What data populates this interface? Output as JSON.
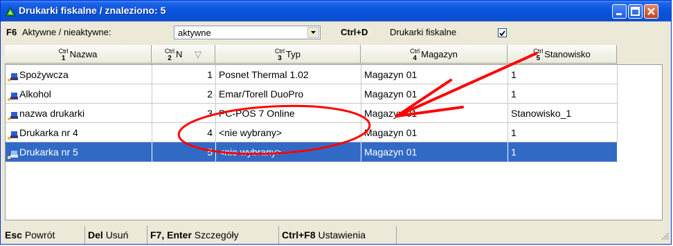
{
  "window": {
    "title": "Drukarki fiskalne / znaleziono: 5"
  },
  "filter": {
    "f6_key": "F6",
    "f6_label": "Aktywne / nieaktywne:",
    "status_value": "aktywne",
    "ctrld_key": "Ctrl+D",
    "ctrld_label": "Drukarki fiskalne",
    "ctrld_checked": true
  },
  "grid": {
    "ctrl_prefix": "Ctrl",
    "columns": [
      {
        "n": "1",
        "label": "Nazwa"
      },
      {
        "n": "2",
        "label": "N"
      },
      {
        "n": "3",
        "label": "Typ"
      },
      {
        "n": "4",
        "label": "Magazyn"
      },
      {
        "n": "5",
        "label": "Stanowisko"
      }
    ],
    "sort_indicator": "▽",
    "rows": [
      {
        "name": "Spożywcza",
        "n": "1",
        "typ": "Posnet Thermal 1.02",
        "magazyn": "Magazyn 01",
        "stanowisko": "1"
      },
      {
        "name": "Alkohol",
        "n": "2",
        "typ": "Emar/Torell DuoPro",
        "magazyn": "Magazyn 01",
        "stanowisko": "1"
      },
      {
        "name": "nazwa drukarki",
        "n": "3",
        "typ": "PC-POS 7 Online",
        "magazyn": "Magazyn 01",
        "stanowisko": "Stanowisko_1"
      },
      {
        "name": "Drukarka nr 4",
        "n": "4",
        "typ": "<nie wybrany>",
        "magazyn": "Magazyn 01",
        "stanowisko": "1"
      },
      {
        "name": "Drukarka nr 5",
        "n": "5",
        "typ": "<nie wybrany>",
        "magazyn": "Magazyn 01",
        "stanowisko": "1"
      }
    ],
    "selected_row": 4
  },
  "statusbar": [
    {
      "key": "Esc",
      "label": "Powrót"
    },
    {
      "key": "Del",
      "label": "Usuń"
    },
    {
      "key": "F7, Enter",
      "label": "Szczegóły"
    },
    {
      "key": "Ctrl+F8",
      "label": "Ustawienia"
    }
  ],
  "colors": {
    "selection": "#316ac5",
    "annotation": "#ff0000",
    "titlebar": "#0854dd"
  }
}
